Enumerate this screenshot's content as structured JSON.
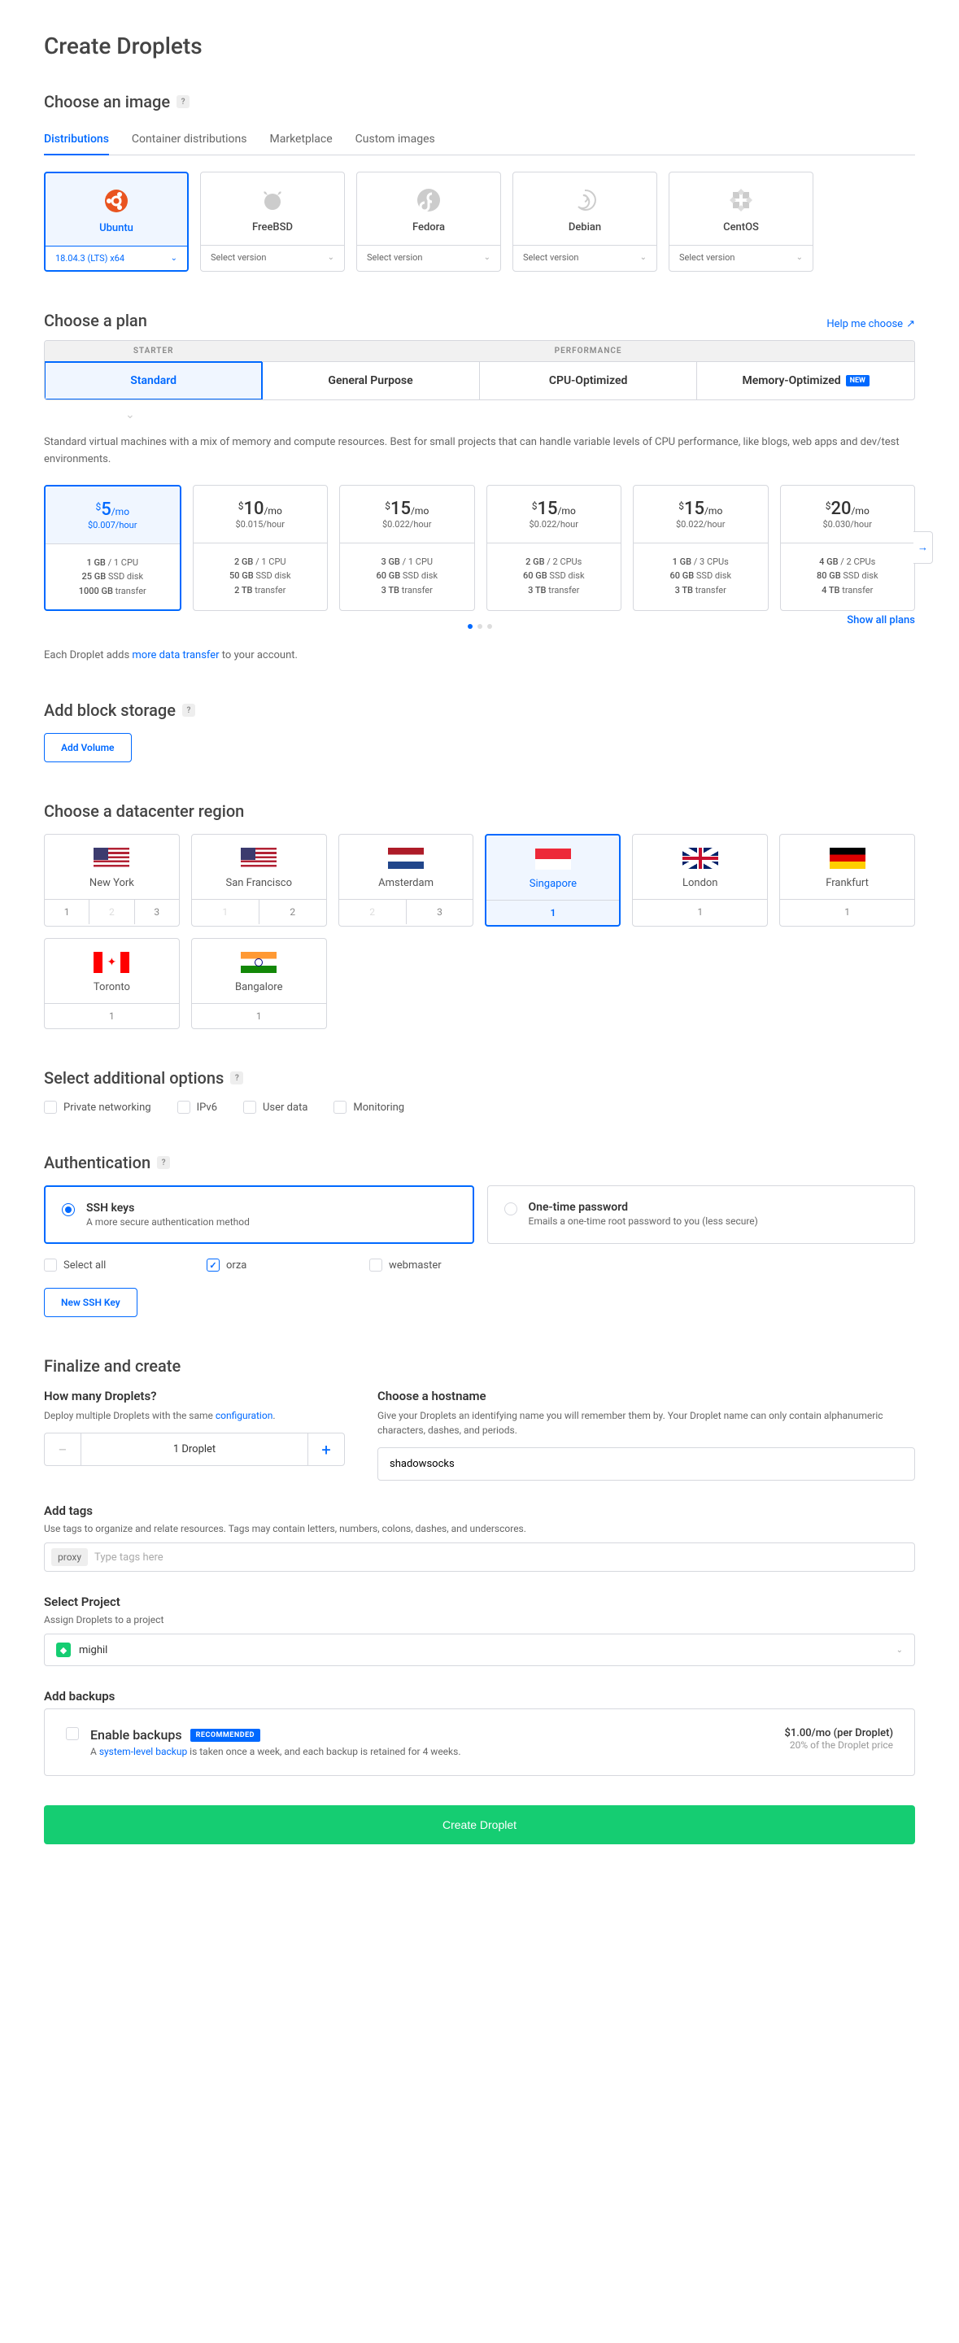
{
  "page_title": "Create Droplets",
  "image": {
    "heading": "Choose an image",
    "tabs": [
      "Distributions",
      "Container distributions",
      "Marketplace",
      "Custom images"
    ],
    "distros": [
      {
        "name": "Ubuntu",
        "version": "18.04.3 (LTS) x64",
        "active": true
      },
      {
        "name": "FreeBSD",
        "version": "Select version"
      },
      {
        "name": "Fedora",
        "version": "Select version"
      },
      {
        "name": "Debian",
        "version": "Select version"
      },
      {
        "name": "CentOS",
        "version": "Select version"
      }
    ]
  },
  "plan": {
    "heading": "Choose a plan",
    "help": "Help me choose",
    "starter_label": "STARTER",
    "perf_label": "PERFORMANCE",
    "options": {
      "standard": "Standard",
      "general": "General Purpose",
      "cpu": "CPU-Optimized",
      "memory": "Memory-Optimized",
      "new_badge": "NEW"
    },
    "desc": "Standard virtual machines with a mix of memory and compute resources. Best for small projects that can handle variable levels of CPU performance, like blogs, web apps and dev/test environments.",
    "prices": [
      {
        "mo": "5",
        "hr": "$0.007/hour",
        "ram": "1 GB",
        "cpu": "1 CPU",
        "disk": "25 GB",
        "tx": "1000 GB",
        "active": true
      },
      {
        "mo": "10",
        "hr": "$0.015/hour",
        "ram": "2 GB",
        "cpu": "1 CPU",
        "disk": "50 GB",
        "tx": "2 TB"
      },
      {
        "mo": "15",
        "hr": "$0.022/hour",
        "ram": "3 GB",
        "cpu": "1 CPU",
        "disk": "60 GB",
        "tx": "3 TB"
      },
      {
        "mo": "15",
        "hr": "$0.022/hour",
        "ram": "2 GB",
        "cpu": "2 CPUs",
        "disk": "60 GB",
        "tx": "3 TB"
      },
      {
        "mo": "15",
        "hr": "$0.022/hour",
        "ram": "1 GB",
        "cpu": "3 CPUs",
        "disk": "60 GB",
        "tx": "3 TB"
      },
      {
        "mo": "20",
        "hr": "$0.030/hour",
        "ram": "4 GB",
        "cpu": "2 CPUs",
        "disk": "80 GB",
        "tx": "4 TB"
      }
    ],
    "show_all": "Show all plans",
    "note_pre": "Each Droplet adds ",
    "note_link": "more data transfer",
    "note_post": " to your account."
  },
  "storage": {
    "heading": "Add block storage",
    "button": "Add Volume"
  },
  "region": {
    "heading": "Choose a datacenter region",
    "list": [
      {
        "name": "New York",
        "flag": "us",
        "nums": [
          "1",
          "2",
          "3"
        ],
        "disabled": [
          1
        ]
      },
      {
        "name": "San Francisco",
        "flag": "us",
        "nums": [
          "1",
          "2"
        ],
        "disabled": [
          0
        ]
      },
      {
        "name": "Amsterdam",
        "flag": "nl",
        "nums": [
          "2",
          "3"
        ],
        "disabled": [
          0
        ]
      },
      {
        "name": "Singapore",
        "flag": "sg",
        "nums": [
          "1"
        ],
        "active": true,
        "active_num": 0
      },
      {
        "name": "London",
        "flag": "uk",
        "nums": [
          "1"
        ]
      },
      {
        "name": "Frankfurt",
        "flag": "de",
        "nums": [
          "1"
        ]
      },
      {
        "name": "Toronto",
        "flag": "ca",
        "nums": [
          "1"
        ]
      },
      {
        "name": "Bangalore",
        "flag": "in",
        "nums": [
          "1"
        ]
      }
    ]
  },
  "options": {
    "heading": "Select additional options",
    "items": [
      "Private networking",
      "IPv6",
      "User data",
      "Monitoring"
    ]
  },
  "auth": {
    "heading": "Authentication",
    "methods": [
      {
        "title": "SSH keys",
        "sub": "A more secure authentication method",
        "active": true
      },
      {
        "title": "One-time password",
        "sub": "Emails a one-time root password to you (less secure)"
      }
    ],
    "keys": {
      "select_all": "Select all",
      "items": [
        {
          "label": "orza",
          "checked": true
        },
        {
          "label": "webmaster",
          "checked": false
        }
      ]
    },
    "new_key_btn": "New SSH Key"
  },
  "finalize": {
    "heading": "Finalize and create",
    "count": {
      "heading": "How many Droplets?",
      "desc_pre": "Deploy multiple Droplets with the same ",
      "desc_link": "configuration",
      "value": "1  Droplet"
    },
    "hostname": {
      "heading": "Choose a hostname",
      "desc": "Give your Droplets an identifying name you will remember them by. Your Droplet name can only contain alphanumeric characters, dashes, and periods.",
      "value": "shadowsocks"
    },
    "tags": {
      "heading": "Add tags",
      "desc": "Use tags to organize and relate resources. Tags may contain letters, numbers, colons, dashes, and underscores.",
      "chip": "proxy",
      "placeholder": "Type tags here"
    },
    "project": {
      "heading": "Select Project",
      "desc": "Assign Droplets to a project",
      "value": "mighil"
    },
    "backups": {
      "heading": "Add backups",
      "title": "Enable backups",
      "badge": "RECOMMENDED",
      "desc_pre": "A ",
      "desc_link": "system-level backup",
      "desc_post": " is taken once a week, and each backup is retained for 4 weeks.",
      "price": "$1.00/mo (per Droplet)",
      "price_sub": "20% of the Droplet price"
    }
  },
  "create_btn": "Create Droplet"
}
